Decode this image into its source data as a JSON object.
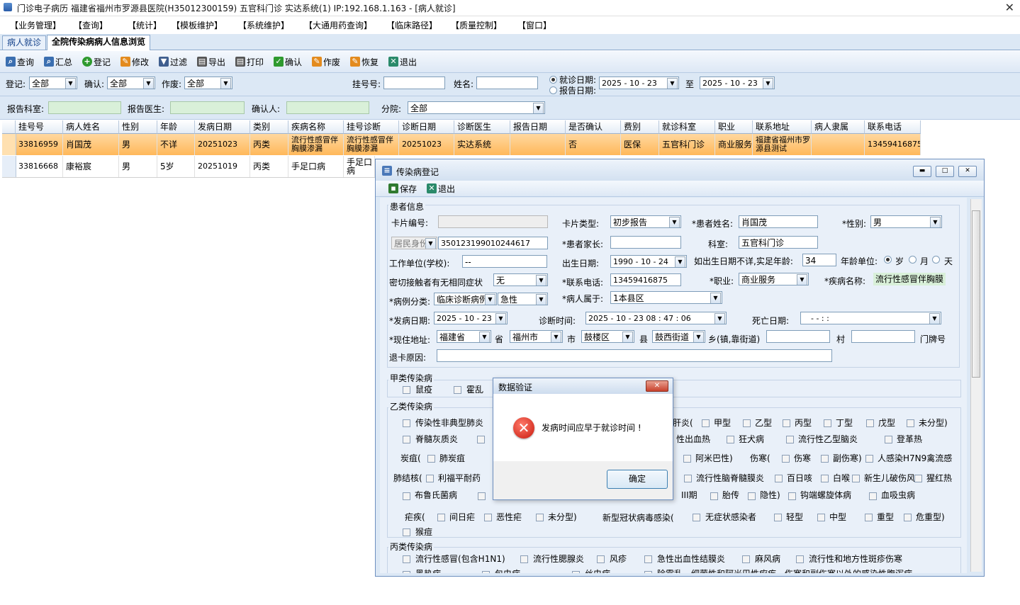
{
  "app": {
    "title": "门诊电子病历  福建省福州市罗源县医院(H35012300159)  五官科门诊  实达系统(1) IP:192.168.1.163  -  [病人就诊]",
    "close_glyph": "✕"
  },
  "menu": [
    "【业务管理】",
    "【查询】",
    "【统计】",
    "【模板维护】",
    "【系统维护】",
    "【大通用药查询】",
    "【临床路径】",
    "【质量控制】",
    "【窗口】"
  ],
  "tabs": [
    "病人就诊",
    "全院传染病病人信息浏览"
  ],
  "toolbar": {
    "query": "查询",
    "summary": "汇总",
    "register": "登记",
    "modify": "修改",
    "filter": "过滤",
    "export": "导出",
    "print": "打印",
    "confirm": "确认",
    "void": "作废",
    "restore": "恢复",
    "exit": "退出"
  },
  "filters": {
    "register_label": "登记:",
    "register_value": "全部",
    "confirm_label": "确认:",
    "confirm_value": "全部",
    "void_label": "作废:",
    "void_value": "全部",
    "reg_no_label": "挂号号:",
    "name_label": "姓名:",
    "visit_date_label": "就诊日期:",
    "report_date_label": "报告日期:",
    "date_from": "2025 - 10 - 23",
    "to_label": "至",
    "date_to": "2025 - 10 - 23",
    "report_dept_label": "报告科室:",
    "report_doctor_label": "报告医生:",
    "confirmer_label": "确认人:",
    "branch_label": "分院:",
    "branch_value": "全部"
  },
  "table": {
    "columns": [
      "挂号号",
      "病人姓名",
      "性别",
      "年龄",
      "发病日期",
      "类别",
      "疾病名称",
      "挂号诊断",
      "诊断日期",
      "诊断医生",
      "报告日期",
      "是否确认",
      "费别",
      "就诊科室",
      "职业",
      "联系地址",
      "病人隶属",
      "联系电话"
    ],
    "rows": [
      [
        "33816959",
        "肖国茂",
        "男",
        "不详",
        "20251023",
        "丙类",
        "流行性感冒伴胸膜渗漏",
        "流行性感冒伴胸膜渗漏",
        "20251023",
        "实达系统",
        "",
        "否",
        "医保",
        "五官科门诊",
        "商业服务",
        "福建省福州市罗源县测试",
        "",
        "13459416875"
      ],
      [
        "33816668",
        "康裕宸",
        "男",
        "5岁",
        "20251019",
        "丙类",
        "手足口病",
        "手足口病",
        "",
        "",
        "",
        "",
        "",
        "",
        "",
        "",
        "",
        ""
      ]
    ]
  },
  "form": {
    "title": "传染病登记",
    "save": "保存",
    "exit": "退出",
    "patient_group": "患者信息",
    "card_no_label": "卡片编号:",
    "card_type_label": "卡片类型:",
    "card_type_value": "初步报告",
    "patient_name_label": "*患者姓名:",
    "patient_name_value": "肖国茂",
    "gender_label": "*性别:",
    "gender_value": "男",
    "id_type_value": "居民身份",
    "id_no_value": "350123199010244617",
    "guardian_label": "*患者家长:",
    "dept_label": "科室:",
    "dept_value": "五官科门诊",
    "work_unit_label": "工作单位(学校):",
    "work_unit_value": "--",
    "birth_label": "出生日期:",
    "birth_value": "1990 - 10 - 24",
    "age_hint_label": "如出生日期不详,实足年龄:",
    "age_value": "34",
    "age_unit_label": "年龄单位:",
    "unit_year": "岁",
    "unit_month": "月",
    "unit_day": "天",
    "contact_symptom_label": "密切接触者有无相同症状",
    "contact_symptom_value": "无",
    "phone_label": "*联系电话:",
    "phone_value": "13459416875",
    "job_label": "*职业:",
    "job_value": "商业服务",
    "disease_label": "*疾病名称:",
    "disease_value": "流行性感冒伴胸膜",
    "case_class_label": "*病例分类:",
    "case_class_value": "临床诊断病例",
    "case_acute_value": "急性",
    "belong_label": "*病人属于:",
    "belong_value": "1本县区",
    "onset_label": "*发病日期:",
    "onset_value": "2025 - 10 - 23",
    "diag_time_label": "诊断时间:",
    "diag_time_value": "2025 - 10 - 23    08 : 47 : 06",
    "death_label": "死亡日期:",
    "death_value": "-    -         :    :",
    "addr_label": "*现住地址:",
    "province_value": "福建省",
    "province_unit": "省",
    "city_value": "福州市",
    "city_unit": "市",
    "county_value": "鼓楼区",
    "county_unit": "县",
    "town_value": "鼓西街道",
    "town_unit": "乡(镇,靠街道)",
    "village_unit": "村",
    "door_unit": "门牌号",
    "withdraw_label": "退卡原因:",
    "class_a": "甲类传染病",
    "a_items": [
      "鼠疫",
      "霍乱"
    ],
    "class_b": "乙类传染病",
    "b_row1": [
      "传染性非典型肺炎",
      "肝炎(",
      "甲型",
      "乙型",
      "丙型",
      "丁型",
      "戊型",
      "未分型)"
    ],
    "b_row2": [
      "脊髓灰质炎",
      "性出血热",
      "狂犬病",
      "流行性乙型脑炎",
      "登革热"
    ],
    "b_row3_prefix": "炭疽(",
    "b_row3": [
      "肺炭疽",
      "阿米巴性)",
      "伤寒(",
      "伤寒",
      "副伤寒)",
      "人感染H7N9禽流感"
    ],
    "b_row4_prefix": "肺结核(",
    "b_row4": [
      "利福平耐药",
      "流行性脑脊髓膜炎",
      "百日咳",
      "白喉",
      "新生儿破伤风",
      "猩红热"
    ],
    "b_row5": [
      "布鲁氏菌病",
      "III期",
      "胎传",
      "隐性)",
      "钩端螺旋体病",
      "血吸虫病"
    ],
    "b_row6_prefix": "疟疾(",
    "b_row6": [
      "间日疟",
      "恶性疟",
      "未分型)"
    ],
    "covid_prefix": "新型冠状病毒感染(",
    "covid_items": [
      "无症状感染者",
      "轻型",
      "中型",
      "重型",
      "危重型)"
    ],
    "b_row7": [
      "猴痘"
    ],
    "class_c": "丙类传染病",
    "c_row1": [
      "流行性感冒(包含H1N1)",
      "流行性腮腺炎",
      "风疹",
      "急性出血性结膜炎",
      "麻风病",
      "流行性和地方性斑疹伤寒"
    ],
    "c_row2": [
      "黑热病",
      "包虫病",
      "丝虫病",
      "除霍乱、细菌性和阿米巴性痢疾、伤寒和副伤寒以外的感染性腹泻病"
    ]
  },
  "dialog": {
    "title": "数据验证",
    "message": "发病时间应早于就诊时间 !",
    "ok": "确定",
    "close_glyph": "✕",
    "error_glyph": "✕"
  }
}
